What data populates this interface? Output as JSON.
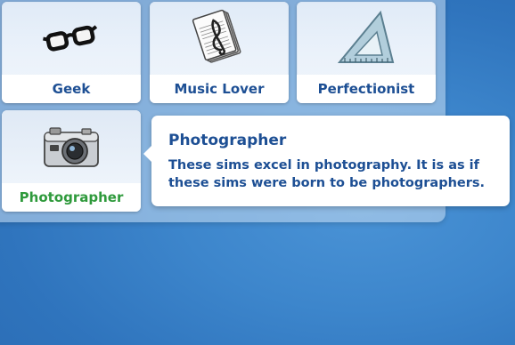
{
  "traits": [
    {
      "label": "Geek",
      "icon": "glasses-icon",
      "selected": false
    },
    {
      "label": "Music Lover",
      "icon": "sheet-music-icon",
      "selected": false
    },
    {
      "label": "Perfectionist",
      "icon": "set-square-icon",
      "selected": false
    },
    {
      "label": "Photographer",
      "icon": "camera-icon",
      "selected": true
    }
  ],
  "tooltip": {
    "title": "Photographer",
    "description": "These sims excel in photography. It is as if these sims were born to be photographers."
  },
  "colors": {
    "label_blue": "#1d4f94",
    "selected_green": "#2f9a3c",
    "background_blue": "#3d86cc"
  }
}
